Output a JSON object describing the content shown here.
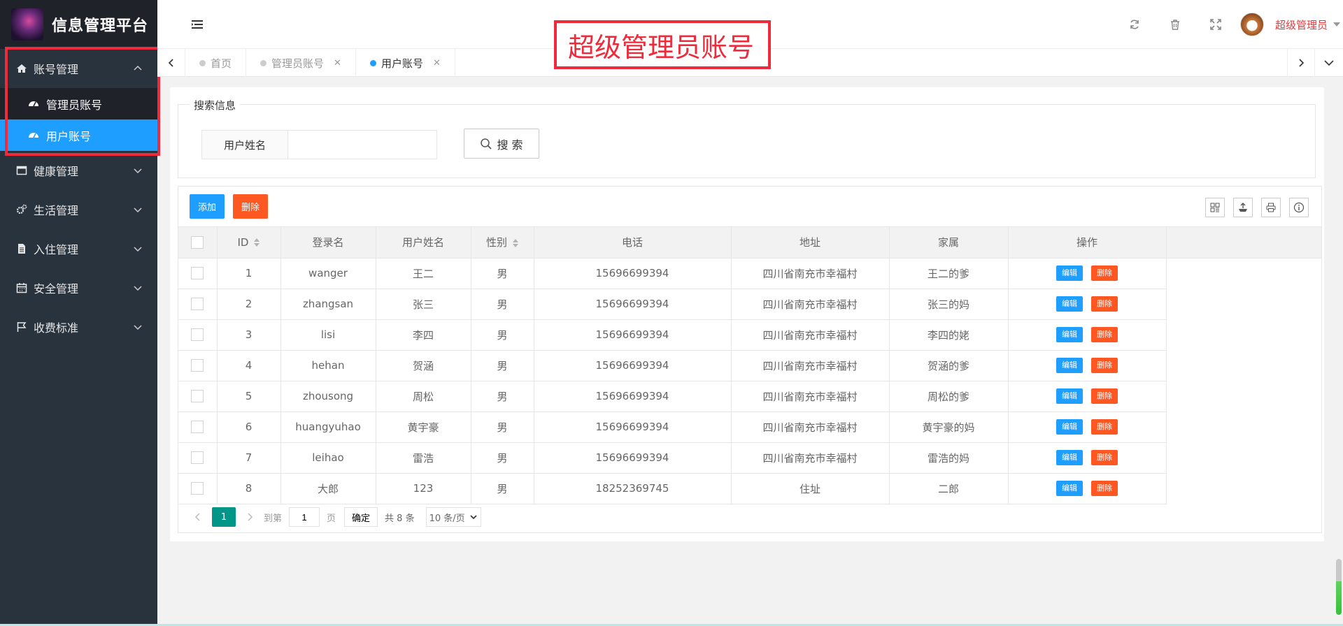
{
  "app": {
    "title": "信息管理平台"
  },
  "sidebar": {
    "groups": [
      {
        "label": "账号管理",
        "icon": "home-icon",
        "expanded": true,
        "children": [
          {
            "label": "管理员账号",
            "icon": "dashboard-icon",
            "active": false
          },
          {
            "label": "用户账号",
            "icon": "dashboard-icon",
            "active": true
          }
        ]
      },
      {
        "label": "健康管理",
        "icon": "window-icon"
      },
      {
        "label": "生活管理",
        "icon": "gears-icon"
      },
      {
        "label": "入住管理",
        "icon": "document-icon"
      },
      {
        "label": "安全管理",
        "icon": "calendar-icon"
      },
      {
        "label": "收费标准",
        "icon": "flag-icon"
      }
    ]
  },
  "header": {
    "username": "超级管理员",
    "icons": [
      "refresh-icon",
      "trash-icon",
      "fullscreen-icon"
    ]
  },
  "annotation": {
    "text": "超级管理员账号",
    "color": "#ee2b3b"
  },
  "tabs": [
    {
      "label": "首页",
      "closable": false,
      "active": false
    },
    {
      "label": "管理员账号",
      "closable": true,
      "active": false
    },
    {
      "label": "用户账号",
      "closable": true,
      "active": true
    }
  ],
  "search": {
    "legend": "搜索信息",
    "field_label": "用户姓名",
    "field_value": "",
    "button": "搜 索"
  },
  "toolbar": {
    "add": "添加",
    "delete": "删除",
    "icons": [
      "columns-icon",
      "export-icon",
      "print-icon",
      "info-icon"
    ]
  },
  "table": {
    "columns": [
      "ID",
      "登录名",
      "用户姓名",
      "性别",
      "电话",
      "地址",
      "家属",
      "操作"
    ],
    "rows": [
      {
        "id": "1",
        "login": "wanger",
        "name": "王二",
        "gender": "男",
        "phone": "15696699394",
        "address": "四川省南充市幸福村",
        "family": "王二的爹"
      },
      {
        "id": "2",
        "login": "zhangsan",
        "name": "张三",
        "gender": "男",
        "phone": "15696699394",
        "address": "四川省南充市幸福村",
        "family": "张三的妈"
      },
      {
        "id": "3",
        "login": "lisi",
        "name": "李四",
        "gender": "男",
        "phone": "15696699394",
        "address": "四川省南充市幸福村",
        "family": "李四的姥"
      },
      {
        "id": "4",
        "login": "hehan",
        "name": "贺涵",
        "gender": "男",
        "phone": "15696699394",
        "address": "四川省南充市幸福村",
        "family": "贺涵的爹"
      },
      {
        "id": "5",
        "login": "zhousong",
        "name": "周松",
        "gender": "男",
        "phone": "15696699394",
        "address": "四川省南充市幸福村",
        "family": "周松的爹"
      },
      {
        "id": "6",
        "login": "huangyuhao",
        "name": "黄宇豪",
        "gender": "男",
        "phone": "15696699394",
        "address": "四川省南充市幸福村",
        "family": "黄宇豪的妈"
      },
      {
        "id": "7",
        "login": "leihao",
        "name": "雷浩",
        "gender": "男",
        "phone": "15696699394",
        "address": "四川省南充市幸福村",
        "family": "雷浩的妈"
      },
      {
        "id": "8",
        "login": "大郎",
        "name": "123",
        "gender": "男",
        "phone": "18252369745",
        "address": "住址",
        "family": "二郎"
      }
    ],
    "row_actions": {
      "edit": "编辑",
      "delete": "删除"
    }
  },
  "pager": {
    "current": "1",
    "goto_label": "到第",
    "goto_value": "1",
    "page_unit": "页",
    "confirm": "确定",
    "total": "共 8 条",
    "page_size": "10 条/页"
  }
}
